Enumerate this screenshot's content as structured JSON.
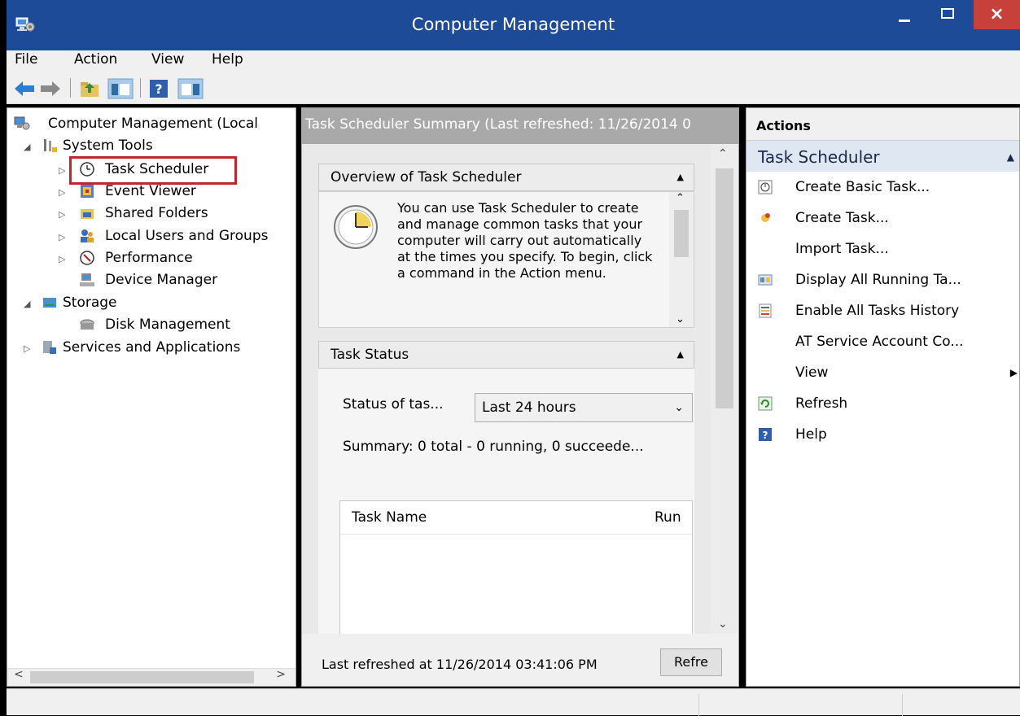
{
  "window": {
    "title": "Computer Management",
    "close_glyph": "×",
    "colors": {
      "titlebar": "#1e4b97",
      "close": "#c7403a",
      "highlight": "#c0272d"
    }
  },
  "menu": [
    "File",
    "Action",
    "View",
    "Help"
  ],
  "toolbar": {
    "icons": [
      "back-arrow-icon",
      "forward-arrow-icon",
      "up-folder-icon",
      "show-hide-tree-icon",
      "help-icon",
      "show-hide-action-pane-icon"
    ]
  },
  "tree": {
    "root": "Computer Management (Local",
    "system_tools": "System Tools",
    "task_scheduler": "Task Scheduler",
    "event_viewer": "Event Viewer",
    "shared_folders": "Shared Folders",
    "local_users": "Local Users and Groups",
    "performance": "Performance",
    "device_manager": "Device Manager",
    "storage": "Storage",
    "disk_management": "Disk Management",
    "services": "Services and Applications"
  },
  "center": {
    "header": "Task Scheduler Summary (Last refreshed: 11/26/2014 0",
    "overview_title": "Overview of Task Scheduler",
    "overview_text": "You can use Task Scheduler to create and manage common tasks that your computer will carry out automatically at the times you specify. To begin, click a command in the Action menu.",
    "status_title": "Task Status",
    "status_label": "Status of tas...",
    "status_select": "Last 24 hours",
    "summary": "Summary: 0 total - 0 running, 0 succeede...",
    "table_headers": [
      "Task Name",
      "Run"
    ],
    "footer_text": "Last refreshed at 11/26/2014 03:41:06 PM",
    "refresh_button": "Refre"
  },
  "actions": {
    "header": "Actions",
    "group": "Task Scheduler",
    "items": [
      {
        "label": "Create Basic Task...",
        "icon": "create-basic-task-icon"
      },
      {
        "label": "Create Task...",
        "icon": "create-task-icon"
      },
      {
        "label": "Import Task...",
        "icon": ""
      },
      {
        "label": "Display All Running Ta...",
        "icon": "running-tasks-icon"
      },
      {
        "label": "Enable All Tasks History",
        "icon": "history-icon"
      },
      {
        "label": "AT Service Account Co...",
        "icon": ""
      },
      {
        "label": "View",
        "icon": ""
      },
      {
        "label": "Refresh",
        "icon": "refresh-icon"
      },
      {
        "label": "Help",
        "icon": "help-icon"
      }
    ]
  }
}
